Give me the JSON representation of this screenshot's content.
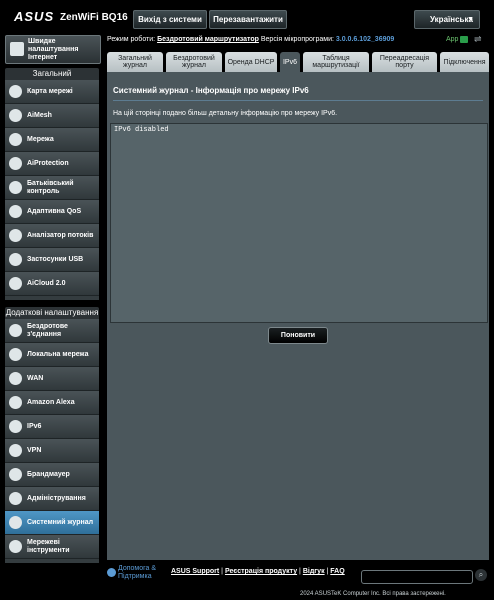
{
  "header": {
    "brand": "ASUS",
    "model": "ZenWiFi BQ16",
    "logout_label": "Вихід з системи",
    "reboot_label": "Перезавантажити",
    "language": "Українська"
  },
  "status": {
    "mode_label": "Режим роботи:",
    "mode_value": "Бездротовий маршрутизатор",
    "fw_label": "Версія мікропрограми:",
    "fw_value": "3.0.0.6.102_36909",
    "app_label": "App"
  },
  "sidebar": {
    "quick_label": "Швидке налаштування Інтернет",
    "general_header": "Загальний",
    "general_items": [
      {
        "label": "Карта мережі",
        "icon": "network-map-icon"
      },
      {
        "label": "AiMesh",
        "icon": "aimesh-icon"
      },
      {
        "label": "Мережа",
        "icon": "network-icon"
      },
      {
        "label": "AiProtection",
        "icon": "aiprotection-icon"
      },
      {
        "label": "Батьківський контроль",
        "icon": "parental-control-icon"
      },
      {
        "label": "Адаптивна QoS",
        "icon": "qos-icon"
      },
      {
        "label": "Аналізатор потоків",
        "icon": "traffic-analyzer-icon"
      },
      {
        "label": "Застосунки USB",
        "icon": "usb-icon"
      },
      {
        "label": "AiCloud 2.0",
        "icon": "aicloud-icon"
      }
    ],
    "advanced_header": "Додаткові налаштування",
    "advanced_items": [
      {
        "label": "Бездротове з'єднання",
        "icon": "wireless-icon"
      },
      {
        "label": "Локальна мережа",
        "icon": "lan-icon"
      },
      {
        "label": "WAN",
        "icon": "wan-icon"
      },
      {
        "label": "Amazon Alexa",
        "icon": "alexa-icon"
      },
      {
        "label": "IPv6",
        "icon": "ipv6-icon"
      },
      {
        "label": "VPN",
        "icon": "vpn-icon"
      },
      {
        "label": "Брандмауер",
        "icon": "firewall-icon"
      },
      {
        "label": "Адміністрування",
        "icon": "administration-icon"
      },
      {
        "label": "Системний журнал",
        "icon": "system-log-icon"
      },
      {
        "label": "Мережеві інструменти",
        "icon": "network-tools-icon"
      }
    ]
  },
  "tabs": [
    "Загальний журнал",
    "Бездротовий журнал",
    "Оренда DHCP",
    "IPv6",
    "Таблиця маршрутизації",
    "Переадресація порту",
    "Підключення"
  ],
  "panel": {
    "title": "Системний журнал - Інформація про мережу IPv6",
    "description": "На цій сторінці подано більш детальну інформацію про мережу IPv6.",
    "log_text": "IPv6 disabled",
    "refresh_label": "Поновити"
  },
  "footer": {
    "help_label": "Допомога & Підтримка",
    "support_link": "ASUS Support",
    "registration_link": "Реєстрація продукту",
    "feedback_link": "Відгук",
    "faq_link": "FAQ",
    "copyright": "2024 ASUSTeK Computer Inc. Всі права застережені."
  },
  "colors": {
    "accent": "#5b9bd5",
    "panel": "#4b575c",
    "active_menu": "#3f86b7"
  }
}
